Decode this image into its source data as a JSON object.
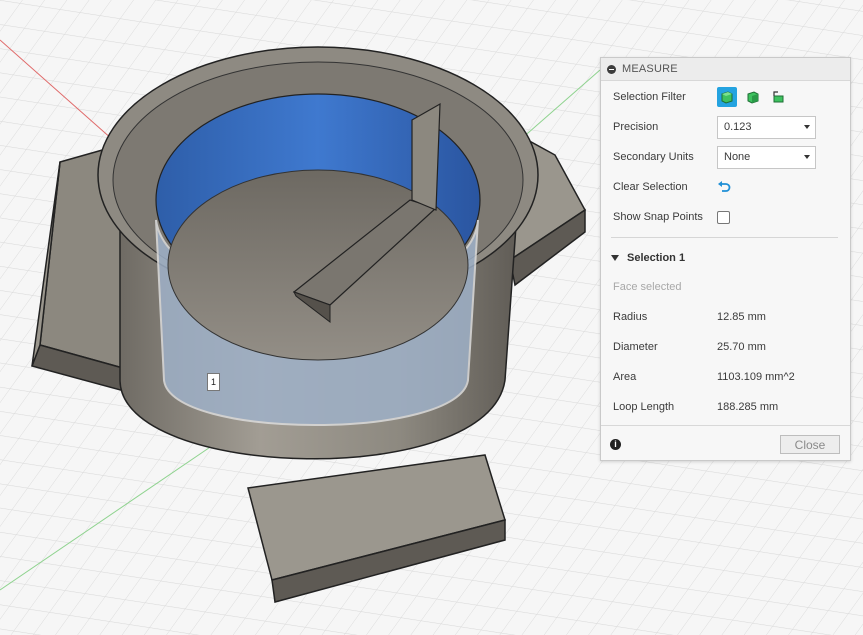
{
  "panel": {
    "title": "MEASURE",
    "selection_filter_label": "Selection Filter",
    "filter_icons": [
      "body-filter-icon",
      "face-filter-icon",
      "edge-filter-icon"
    ],
    "precision": {
      "label": "Precision",
      "value": "0.123"
    },
    "secondary_units": {
      "label": "Secondary Units",
      "value": "None"
    },
    "clear_selection_label": "Clear Selection",
    "show_snap_points_label": "Show Snap Points",
    "show_snap_points_checked": false,
    "selection": {
      "header": "Selection 1",
      "status": "Face selected",
      "rows": [
        {
          "label": "Radius",
          "value": "12.85 mm"
        },
        {
          "label": "Diameter",
          "value": "25.70 mm"
        },
        {
          "label": "Area",
          "value": "1103.109 mm^2"
        },
        {
          "label": "Loop Length",
          "value": "188.285 mm"
        }
      ]
    },
    "close_label": "Close"
  },
  "viewport": {
    "selection_marker": "1",
    "colors": {
      "accent": "#24a3e0",
      "face_highlight": "#3d74c8",
      "body": "#8f8b83"
    }
  }
}
